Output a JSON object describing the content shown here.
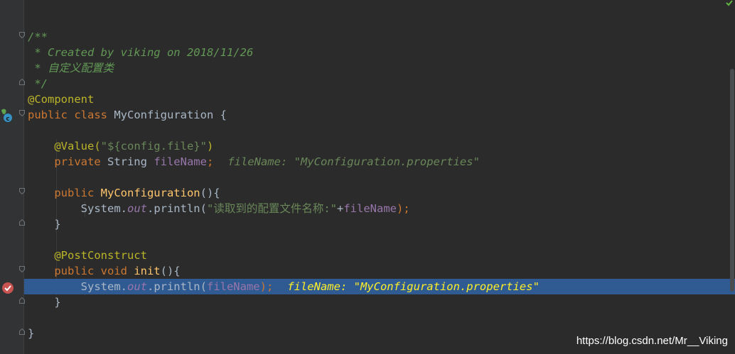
{
  "code": {
    "l2_comment": "/**",
    "l3_comment": " * Created by viking on 2018/11/26",
    "l4_comment": " * 自定义配置类",
    "l5_comment": " */",
    "l6_annotation": "@Component",
    "l7_kw": "public class ",
    "l7_name": "MyConfiguration",
    "l7_brace": " {",
    "l9_annotation": "@Value(",
    "l9_string": "\"${config.file}\"",
    "l9_paren": ")",
    "l10_kw": "private ",
    "l10_type": "String ",
    "l10_field": "fileName",
    "l10_semi": ";",
    "l10_hint": "fileName: \"MyConfiguration.properties\"",
    "l12_kw": "public ",
    "l12_ctor": "MyConfiguration",
    "l12_rest": "(){",
    "l13_sys": "System.",
    "l13_out": "out",
    "l13_println": ".println(",
    "l13_string": "\"读取到的配置文件名称:\"",
    "l13_plus": "+",
    "l13_field": "fileName",
    "l13_end": ");",
    "l14_brace": "}",
    "l16_annotation": "@PostConstruct",
    "l17_kw": "public void ",
    "l17_method": "init",
    "l17_rest": "(){",
    "l18_sys": "System.",
    "l18_out": "out",
    "l18_println": ".println(",
    "l18_field": "fileName",
    "l18_end": ");",
    "l18_hint": "fileName: \"MyConfiguration.properties\"",
    "l19_brace": "}",
    "l21_brace": "}"
  },
  "watermark": "https://blog.csdn.net/Mr__Viking",
  "colors": {
    "background": "#2b2b2b",
    "gutter": "#313335",
    "highlight": "#2f5a92",
    "comment": "#629755",
    "annotation": "#bbb529",
    "keyword": "#cc7832",
    "string": "#6a8759",
    "field": "#9876aa",
    "function": "#ffc66d",
    "breakpoint": "#c75450"
  },
  "icons": [
    "fold-icon",
    "implementation-icon",
    "breakpoint-icon",
    "check-icon"
  ]
}
